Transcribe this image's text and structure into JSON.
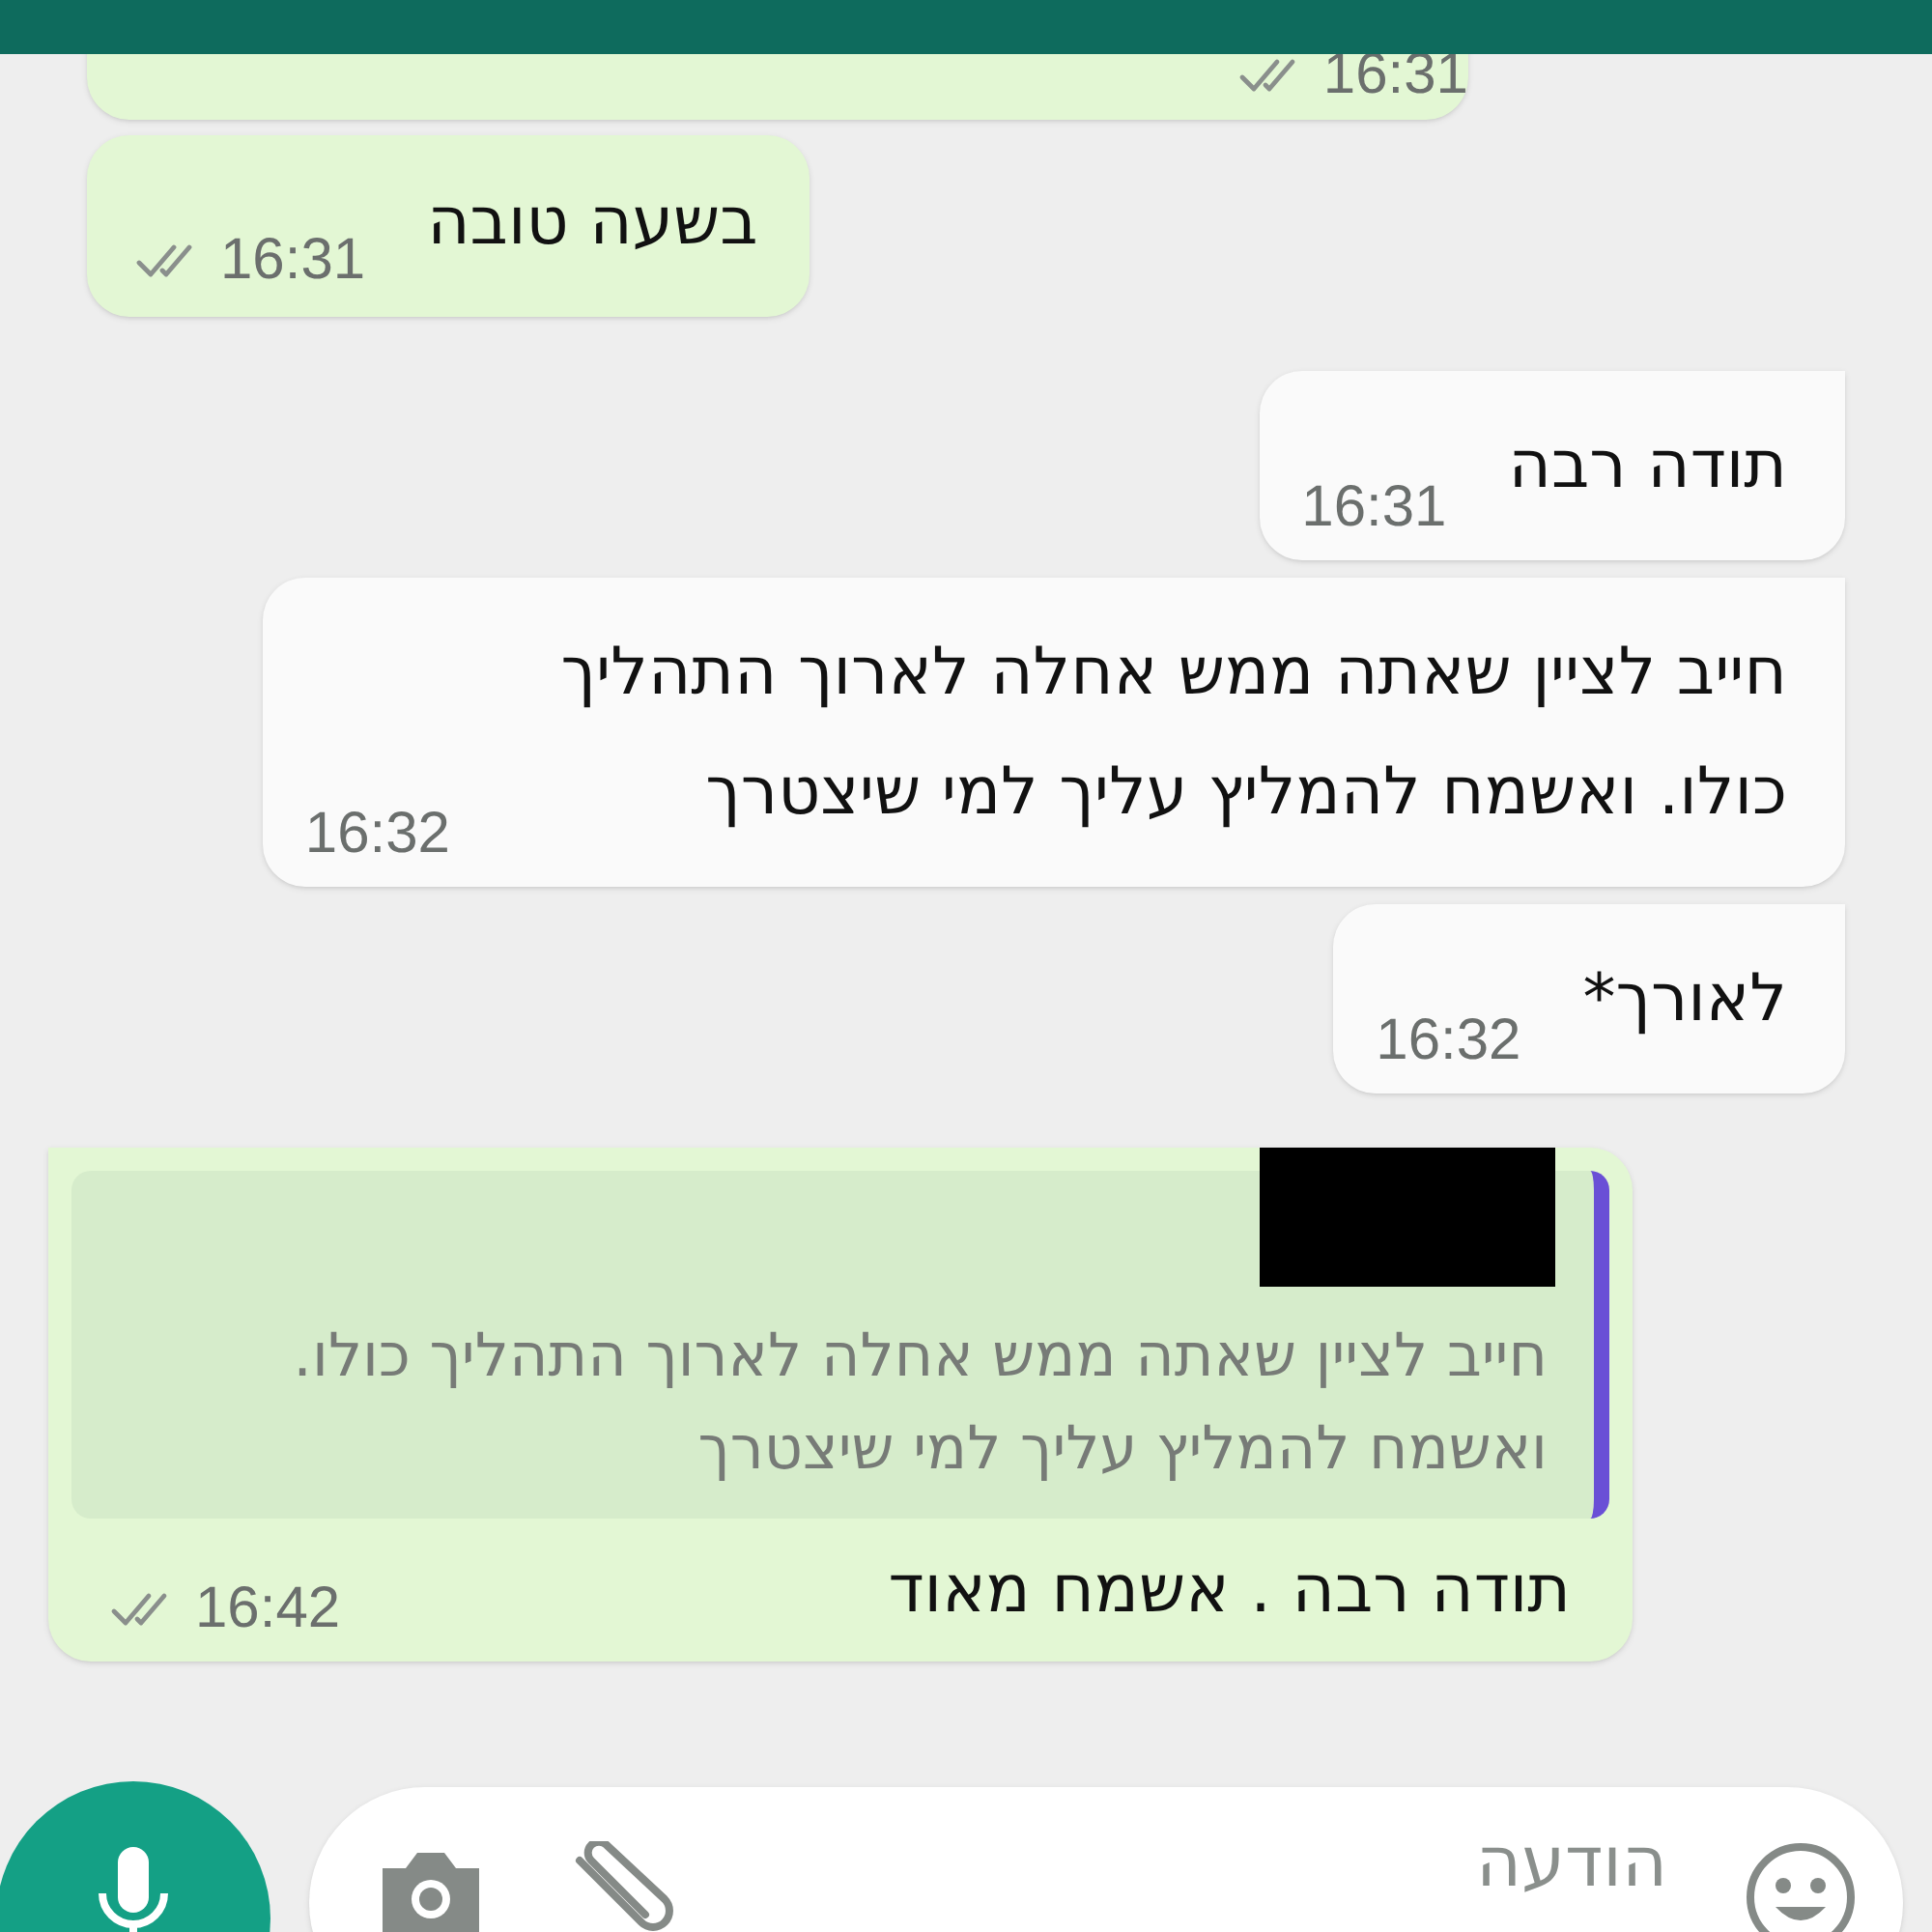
{
  "messages": [
    {
      "kind": "sent",
      "time": "16:31",
      "read": false
    },
    {
      "kind": "sent",
      "text": "בשעה טובה",
      "time": "16:31",
      "read": false
    },
    {
      "kind": "received",
      "text": "תודה רבה",
      "time": "16:31"
    },
    {
      "kind": "received",
      "text": "חייב לציין שאתה ממש אחלה לארוך התהליך כולו. ואשמח להמליץ עליך למי שיצטרך",
      "time": "16:32"
    },
    {
      "kind": "received",
      "text": "לאורך*",
      "time": "16:32"
    },
    {
      "kind": "reply",
      "quote": {
        "author_redacted": true,
        "text": "חייב לציין שאתה ממש אחלה לארוך התהליך כולו. ואשמח להמליץ עליך למי שיצטרך"
      },
      "text": "תודה רבה . אשמח מאוד",
      "time": "16:42",
      "read": false
    }
  ],
  "composer": {
    "placeholder": "הודעה"
  }
}
